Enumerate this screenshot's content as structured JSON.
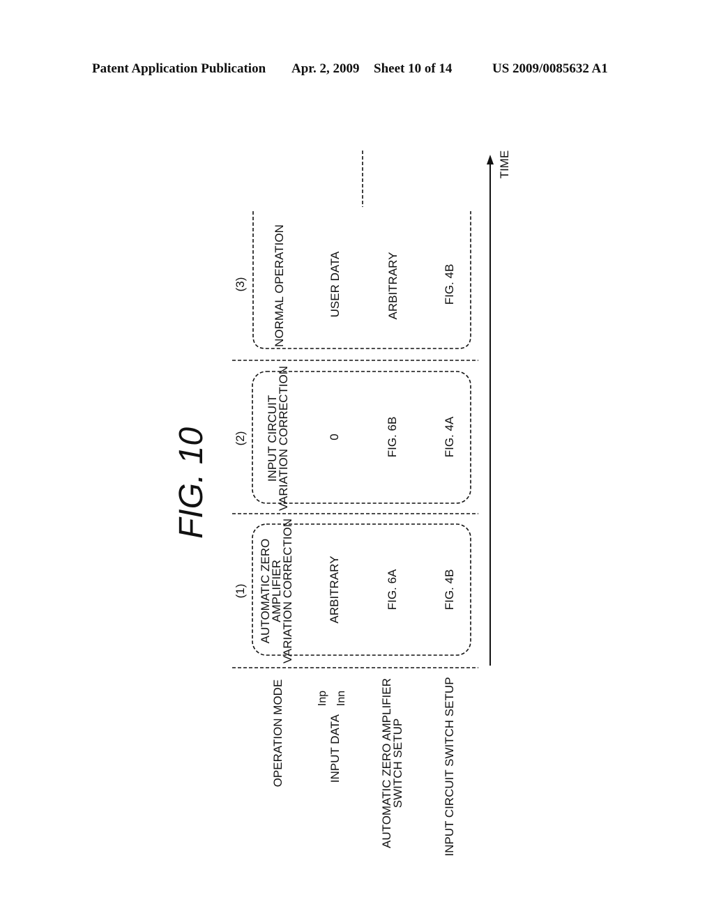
{
  "header": {
    "publication": "Patent Application Publication",
    "date": "Apr. 2, 2009",
    "sheet": "Sheet 10 of 14",
    "number": "US 2009/0085632 A1"
  },
  "figure": {
    "title": "FIG. 10",
    "time_axis_label": "TIME",
    "row_labels": {
      "operation_mode": "OPERATION MODE",
      "input_data": "INPUT DATA",
      "input_data_inp": "Inp",
      "input_data_inn": "Inn",
      "az_switch_line1": "AUTOMATIC ZERO AMPLIFIER",
      "az_switch_line2": "SWITCH SETUP",
      "input_circuit_switch": "INPUT CIRCUIT SWITCH SETUP"
    },
    "phases": [
      {
        "number": "(1)",
        "mode_lines": [
          "AUTOMATIC ZERO",
          "AMPLIFIER",
          "VARIATION CORRECTION"
        ],
        "input_data": "ARBITRARY",
        "az_switch": "FIG. 6A",
        "input_switch": "FIG. 4B"
      },
      {
        "number": "(2)",
        "mode_lines": [
          "INPUT CIRCUIT",
          "VARIATION CORRECTION"
        ],
        "input_data": "0",
        "az_switch": "FIG. 6B",
        "input_switch": "FIG. 4A"
      },
      {
        "number": "(3)",
        "mode_lines": [
          "NORMAL OPERATION"
        ],
        "input_data": "USER DATA",
        "az_switch": "ARBITRARY",
        "input_switch": "FIG. 4B"
      }
    ]
  }
}
